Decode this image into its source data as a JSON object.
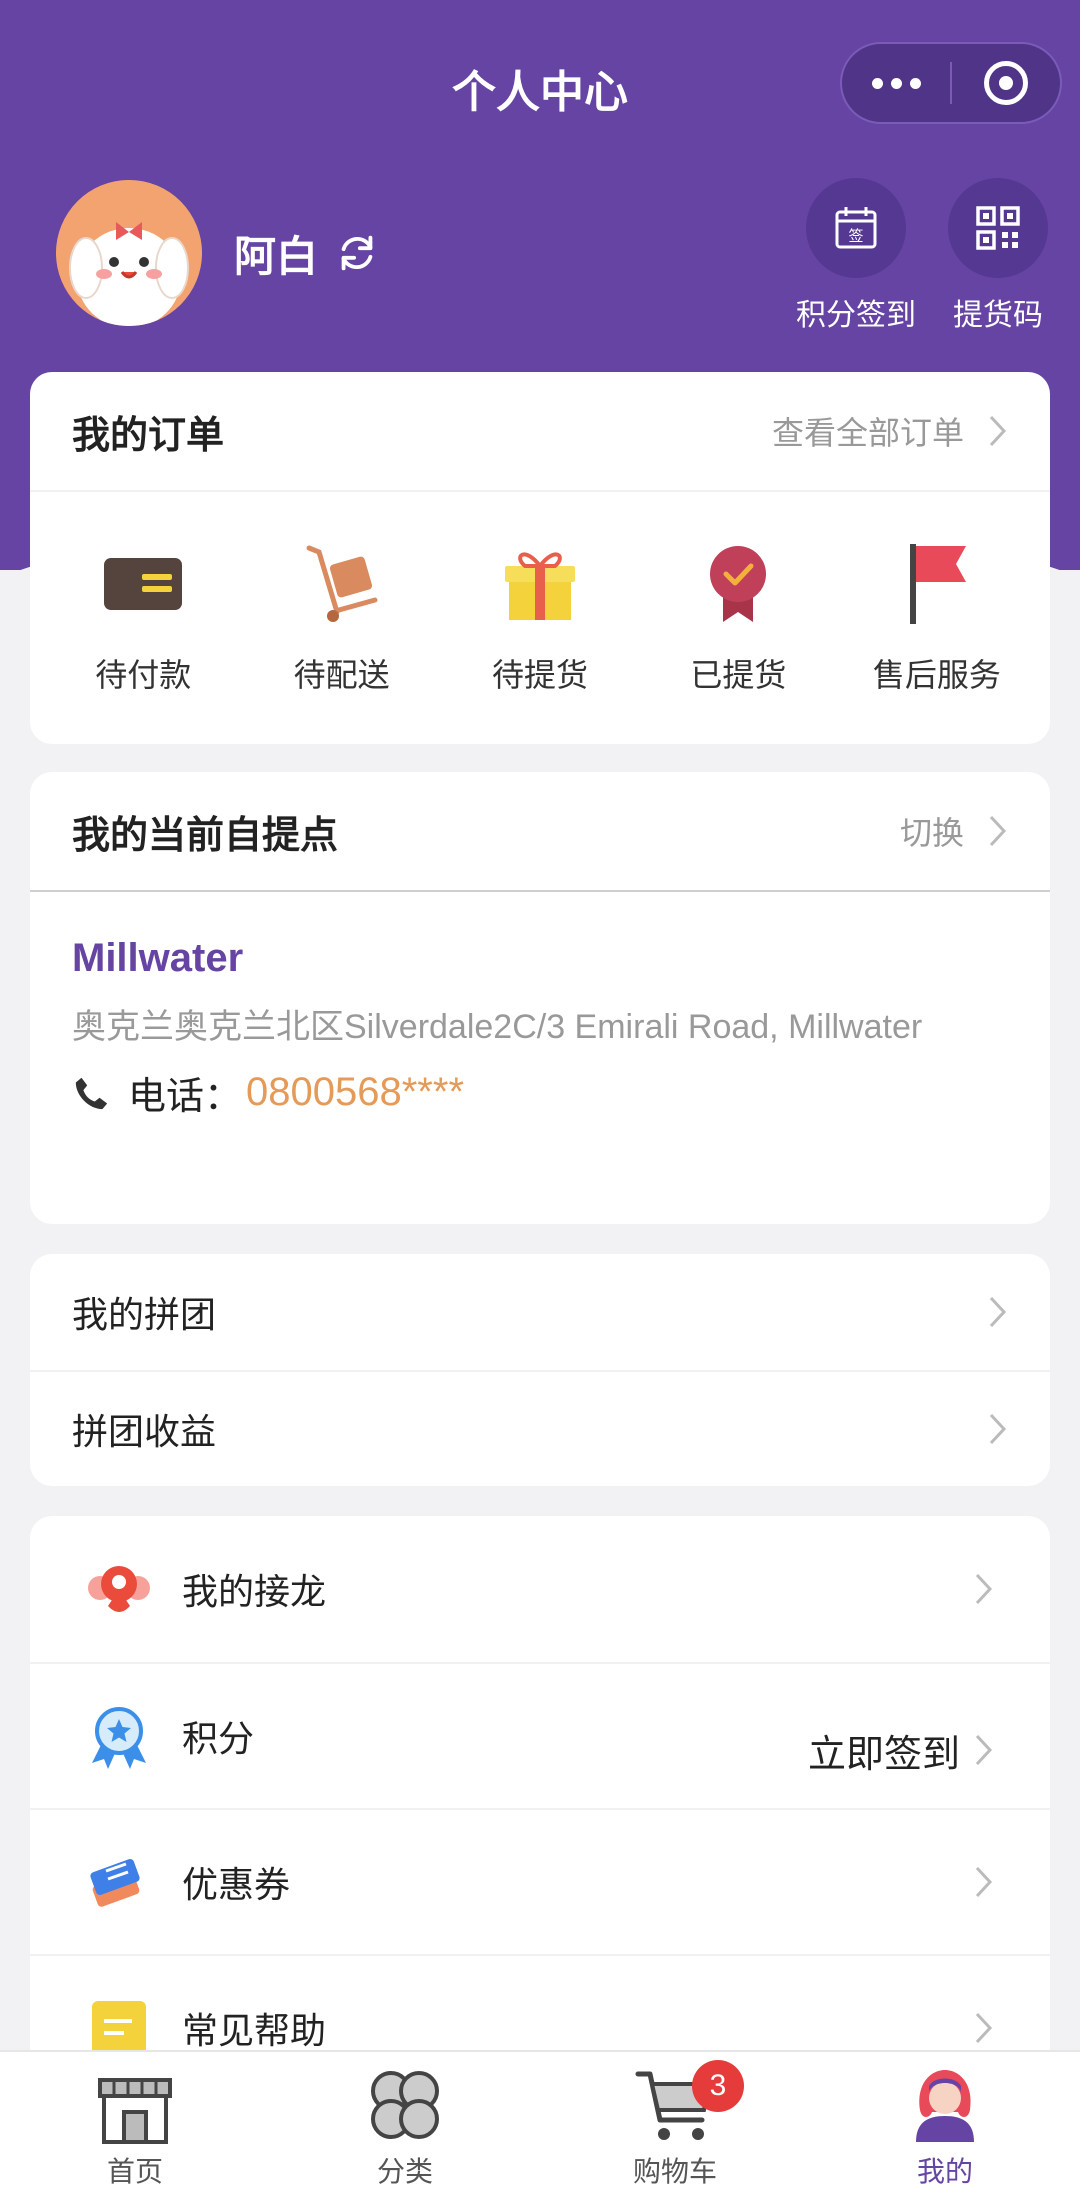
{
  "header": {
    "title": "个人中心"
  },
  "profile": {
    "username": "阿白"
  },
  "quick_actions": [
    {
      "label": "积分签到",
      "icon": "calendar-sign-icon"
    },
    {
      "label": "提货码",
      "icon": "qr-code-icon"
    }
  ],
  "orders": {
    "title": "我的订单",
    "view_all": "查看全部订单",
    "items": [
      {
        "label": "待付款",
        "icon": "card-icon"
      },
      {
        "label": "待配送",
        "icon": "hand-truck-icon"
      },
      {
        "label": "待提货",
        "icon": "gift-icon"
      },
      {
        "label": "已提货",
        "icon": "medal-icon"
      },
      {
        "label": "售后服务",
        "icon": "flag-icon"
      }
    ]
  },
  "pickup": {
    "title": "我的当前自提点",
    "switch_label": "切换",
    "store_name": "Millwater",
    "address": "奥克兰奥克兰北区Silverdale2C/3 Emirali Road, Millwater",
    "phone_label": "电话：",
    "phone": "0800568****"
  },
  "group": {
    "items": [
      "我的拼团",
      "拼团收益"
    ]
  },
  "menu": {
    "items": [
      {
        "label": "我的接龙",
        "icon": "chain-icon",
        "extra": ""
      },
      {
        "label": "积分",
        "icon": "points-badge-icon",
        "extra": "立即签到"
      },
      {
        "label": "优惠券",
        "icon": "coupon-icon",
        "extra": ""
      },
      {
        "label": "常见帮助",
        "icon": "help-note-icon",
        "extra": ""
      }
    ]
  },
  "tabbar": {
    "items": [
      {
        "label": "首页",
        "icon": "store-icon"
      },
      {
        "label": "分类",
        "icon": "category-icon"
      },
      {
        "label": "购物车",
        "icon": "cart-icon",
        "badge": "3"
      },
      {
        "label": "我的",
        "icon": "user-avatar-icon"
      }
    ]
  },
  "colors": {
    "brand_purple": "#6644a3",
    "phone_orange": "#e59a57",
    "badge_red": "#e63b3b"
  }
}
